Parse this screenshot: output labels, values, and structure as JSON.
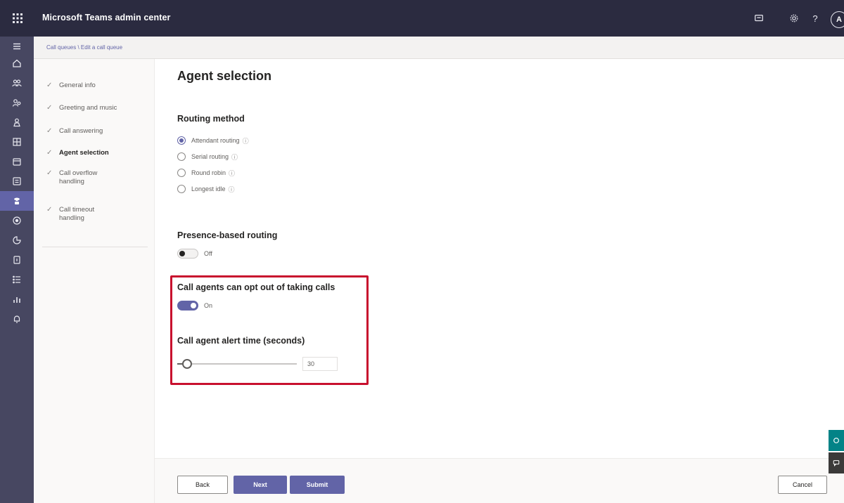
{
  "header": {
    "app_title": "Microsoft Teams admin center",
    "avatar_initial": "A",
    "help_label": "?"
  },
  "breadcrumb": "Call queues \\ Edit a call queue",
  "wizard": {
    "steps": [
      {
        "label": "General info",
        "done": true
      },
      {
        "label": "Greeting and music",
        "done": true
      },
      {
        "label": "Call answering",
        "done": true
      },
      {
        "label": "Agent selection",
        "done": true,
        "current": true
      },
      {
        "label": "Call overflow handling",
        "done": true
      },
      {
        "label": "Call timeout handling",
        "done": true
      }
    ]
  },
  "main": {
    "title": "Agent selection",
    "routing": {
      "heading": "Routing method",
      "options": [
        {
          "label": "Attendant routing",
          "selected": true
        },
        {
          "label": "Serial routing",
          "selected": false
        },
        {
          "label": "Round robin",
          "selected": false
        },
        {
          "label": "Longest idle",
          "selected": false
        }
      ],
      "info_glyph": "ⓘ"
    },
    "presence": {
      "heading": "Presence-based routing",
      "state_label": "Off",
      "value": false
    },
    "opt_out": {
      "heading": "Call agents can opt out of taking calls",
      "state_label": "On",
      "value": true
    },
    "alert_time": {
      "heading": "Call agent alert time (seconds)",
      "value": "30",
      "slider_fraction": 0.08
    }
  },
  "footer": {
    "back_label": "Back",
    "next_label": "Next",
    "submit_label": "Submit",
    "cancel_label": "Cancel"
  },
  "colors": {
    "brand": "#6264a7",
    "header": "#2b2b40",
    "rail": "#474761",
    "highlight": "#c8102e"
  }
}
